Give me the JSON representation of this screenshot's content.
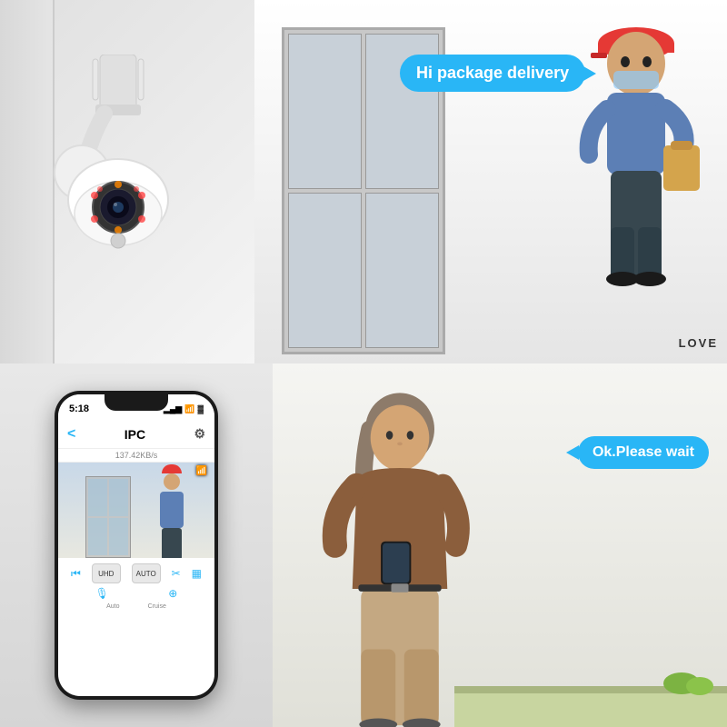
{
  "topHalf": {
    "speechBubble": "Hi package delivery",
    "loveText": "LOVE"
  },
  "bottomHalf": {
    "speechBubble": "Ok.Please wait",
    "phone": {
      "time": "5:18",
      "title": "IPC",
      "bandwidth": "137.42KB/s",
      "signal": "▂▄▆",
      "wifi": "WiFi",
      "battery": "🔋",
      "backArrow": "<",
      "gearIcon": "⚙",
      "uhd": "UHD",
      "auto": "AUTO"
    }
  }
}
